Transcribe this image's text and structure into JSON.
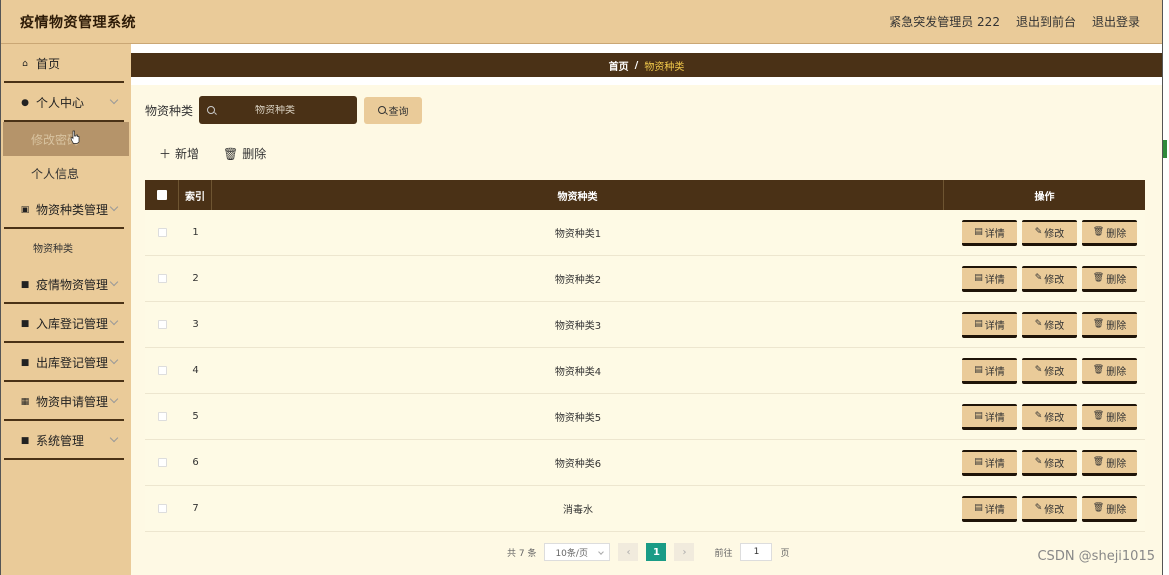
{
  "header": {
    "app_title": "疫情物资管理系统",
    "user_label": "紧急突发管理员 222",
    "to_front": "退出到前台",
    "logout": "退出登录"
  },
  "sidebar": {
    "items": [
      {
        "label": "首页",
        "icon": "home-icon"
      },
      {
        "label": "个人中心",
        "icon": "user-icon",
        "sub": [
          {
            "label": "修改密码",
            "active": true
          },
          {
            "label": "个人信息"
          }
        ]
      },
      {
        "label": "物资种类管理",
        "icon": "clipboard-icon",
        "sub": [
          {
            "label": "物资种类"
          }
        ]
      },
      {
        "label": "疫情物资管理",
        "icon": "grid-icon"
      },
      {
        "label": "入库登记管理",
        "icon": "grid-icon"
      },
      {
        "label": "出库登记管理",
        "icon": "grid-icon"
      },
      {
        "label": "物资申请管理",
        "icon": "table-icon"
      },
      {
        "label": "系统管理",
        "icon": "grid-icon"
      }
    ]
  },
  "breadcrumb": {
    "home": "首页",
    "sep": "/",
    "current": "物资种类"
  },
  "search": {
    "label": "物资种类",
    "placeholder": "物资种类",
    "button": "查询"
  },
  "actions": {
    "add": "新增",
    "delete": "删除"
  },
  "table": {
    "headers": {
      "index": "索引",
      "name": "物资种类",
      "ops": "操作"
    },
    "rows": [
      {
        "index": "1",
        "name": "物资种类1"
      },
      {
        "index": "2",
        "name": "物资种类2"
      },
      {
        "index": "3",
        "name": "物资种类3"
      },
      {
        "index": "4",
        "name": "物资种类4"
      },
      {
        "index": "5",
        "name": "物资种类5"
      },
      {
        "index": "6",
        "name": "物资种类6"
      },
      {
        "index": "7",
        "name": "消毒水"
      }
    ],
    "op_labels": {
      "detail": "详情",
      "edit": "修改",
      "delete": "删除"
    }
  },
  "pager": {
    "total": "共 7 条",
    "page_size": "10条/页",
    "current": "1",
    "goto_label": "前往",
    "goto_value": "1",
    "page_suffix": "页"
  },
  "watermark": "CSDN @sheji1015",
  "colors": {
    "header_bg": "#eacb99",
    "dark_brown": "#4a3116",
    "panel_bg": "#fef9e4",
    "pager_active": "#1a9c86"
  }
}
